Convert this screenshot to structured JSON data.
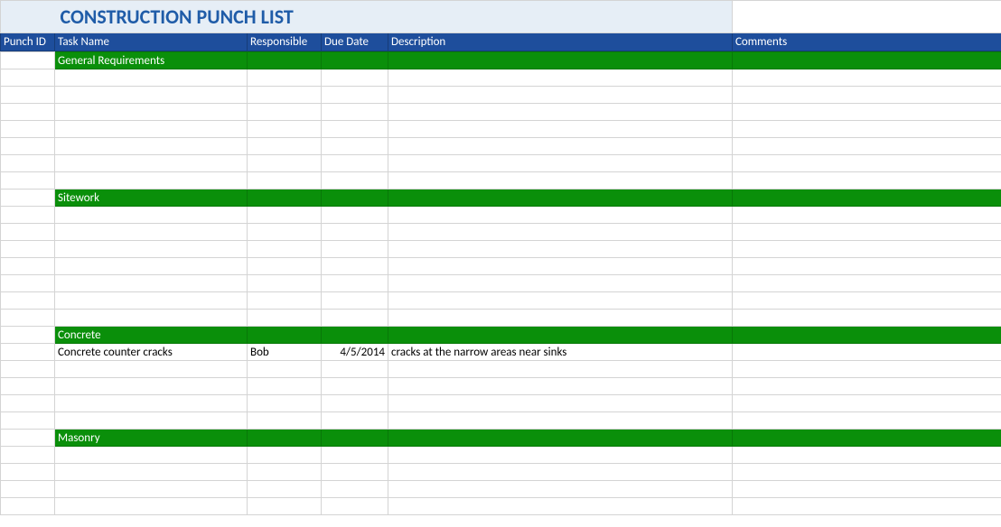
{
  "title": "CONSTRUCTION PUNCH LIST",
  "headers": {
    "punch_id": "Punch ID",
    "task_name": "Task Name",
    "responsible": "Responsible",
    "due_date": "Due Date",
    "description": "Description",
    "comments": "Comments"
  },
  "sections": [
    {
      "name": "General Requirements",
      "rows": 7
    },
    {
      "name": "Sitework",
      "rows": 7
    },
    {
      "name": "Concrete",
      "rows": 5,
      "data": [
        {
          "punch_id": "",
          "task_name": "Concrete counter cracks",
          "responsible": "Bob",
          "due_date": "4/5/2014",
          "description": "cracks at the narrow areas near sinks",
          "comments": ""
        }
      ]
    },
    {
      "name": "Masonry",
      "rows": 4
    }
  ]
}
